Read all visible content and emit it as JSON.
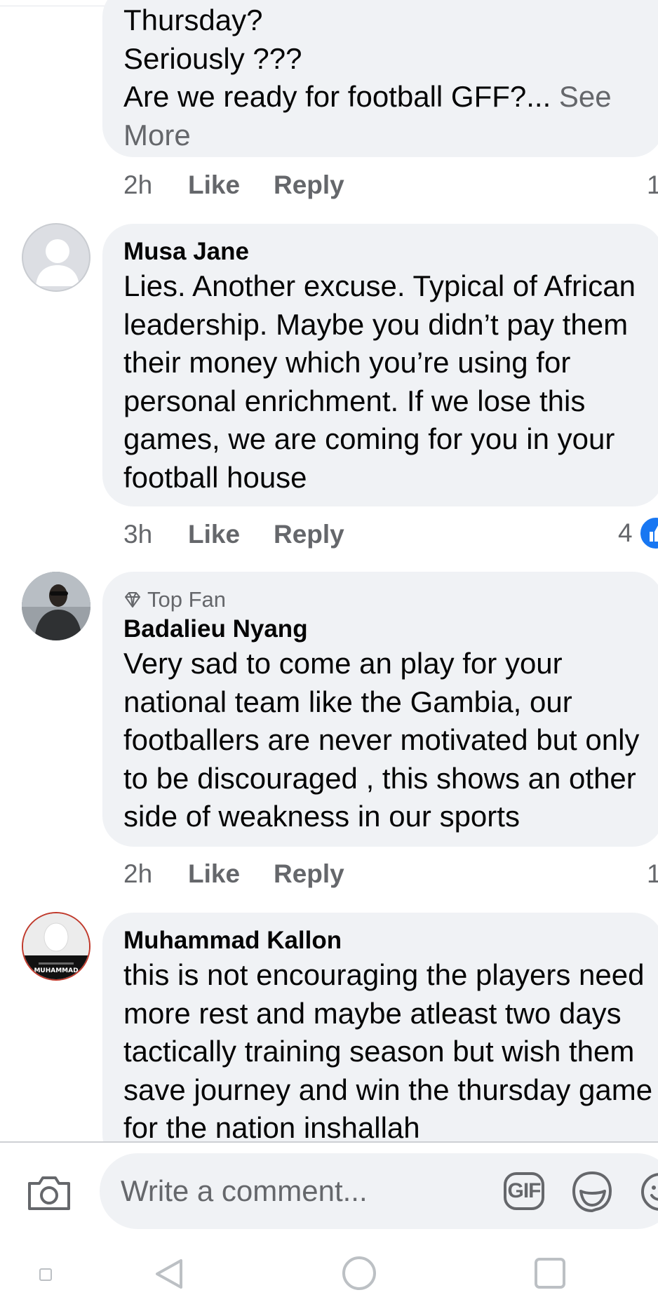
{
  "comments": [
    {
      "author": "",
      "text": "Thursday?\nSeriously ???\nAre we ready for football GFF?...",
      "see_more": "See\nMore",
      "time": "2h",
      "like_label": "Like",
      "reply_label": "Reply",
      "reaction_count": "1"
    },
    {
      "author": "Musa Jane",
      "text": "Lies. Another excuse. Typical of African\nleadership. Maybe you didn’t pay them\ntheir money which you’re using for\npersonal enrichment. If we lose this\ngames, we are coming for you in your\nfootball house",
      "time": "3h",
      "like_label": "Like",
      "reply_label": "Reply",
      "reaction_count": "4",
      "reaction_icon": "like-icon"
    },
    {
      "badge": "Top Fan",
      "author": "Badalieu Nyang",
      "text": "Very sad to come an play for your\nnational team like the Gambia, our\nfootballers are never motivated but only\nto be discouraged , this shows an other\nside of weakness in our sports",
      "time": "2h",
      "like_label": "Like",
      "reply_label": "Reply",
      "reaction_count": "1"
    },
    {
      "author": "Muhammad Kallon",
      "text": "this is not encouraging the players need\nmore rest and maybe atleast two days\ntactically training season but wish them\nsave journey and win the thursday game\nfor the nation inshallah",
      "avatar_logo_text": "MUHAMMAD"
    }
  ],
  "composer": {
    "placeholder": "Write a comment...",
    "gif_label": "GIF"
  },
  "colors": {
    "bubble_bg": "#f0f2f5",
    "secondary_text": "#65676b",
    "like_blue": "#1877f2"
  }
}
